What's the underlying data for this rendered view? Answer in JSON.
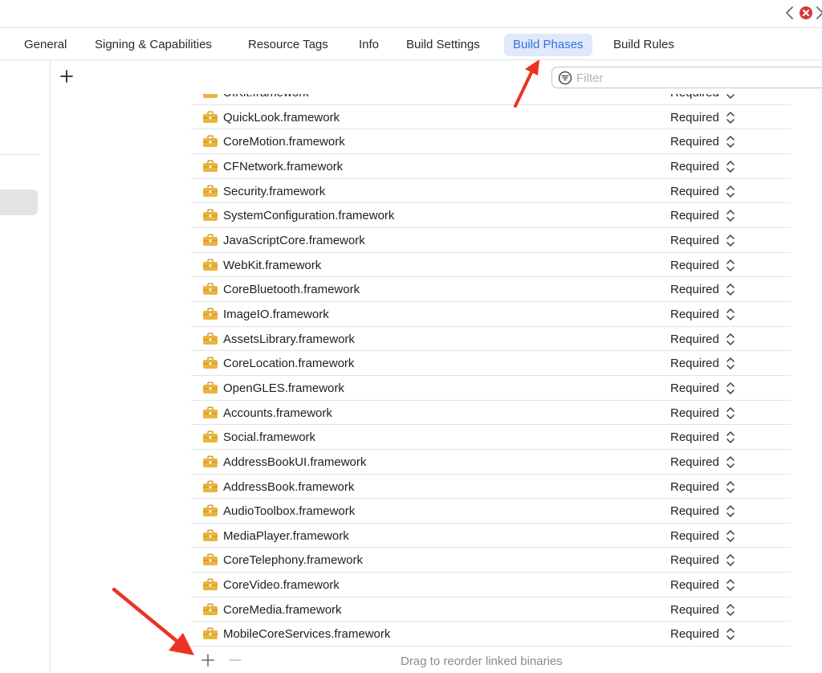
{
  "tabs": [
    {
      "label": "General",
      "active": false
    },
    {
      "label": "Signing & Capabilities",
      "active": false
    },
    {
      "label": "Resource Tags",
      "active": false
    },
    {
      "label": "Info",
      "active": false
    },
    {
      "label": "Build Settings",
      "active": false
    },
    {
      "label": "Build Phases",
      "active": true
    },
    {
      "label": "Build Rules",
      "active": false
    }
  ],
  "toolbar": {
    "add_icon": "plus-icon",
    "filter": {
      "placeholder": "Filter",
      "value": "",
      "icon": "filter-icon"
    }
  },
  "frameworks": [
    {
      "name": "UIKit.framework",
      "status": "Required"
    },
    {
      "name": "QuickLook.framework",
      "status": "Required"
    },
    {
      "name": "CoreMotion.framework",
      "status": "Required"
    },
    {
      "name": "CFNetwork.framework",
      "status": "Required"
    },
    {
      "name": "Security.framework",
      "status": "Required"
    },
    {
      "name": "SystemConfiguration.framework",
      "status": "Required"
    },
    {
      "name": "JavaScriptCore.framework",
      "status": "Required"
    },
    {
      "name": "WebKit.framework",
      "status": "Required"
    },
    {
      "name": "CoreBluetooth.framework",
      "status": "Required"
    },
    {
      "name": "ImageIO.framework",
      "status": "Required"
    },
    {
      "name": "AssetsLibrary.framework",
      "status": "Required"
    },
    {
      "name": "CoreLocation.framework",
      "status": "Required"
    },
    {
      "name": "OpenGLES.framework",
      "status": "Required"
    },
    {
      "name": "Accounts.framework",
      "status": "Required"
    },
    {
      "name": "Social.framework",
      "status": "Required"
    },
    {
      "name": "AddressBookUI.framework",
      "status": "Required"
    },
    {
      "name": "AddressBook.framework",
      "status": "Required"
    },
    {
      "name": "AudioToolbox.framework",
      "status": "Required"
    },
    {
      "name": "MediaPlayer.framework",
      "status": "Required"
    },
    {
      "name": "CoreTelephony.framework",
      "status": "Required"
    },
    {
      "name": "CoreVideo.framework",
      "status": "Required"
    },
    {
      "name": "CoreMedia.framework",
      "status": "Required"
    },
    {
      "name": "MobileCoreServices.framework",
      "status": "Required"
    }
  ],
  "footer": {
    "hint": "Drag to reorder linked binaries",
    "add_icon": "plus-icon",
    "remove_icon": "minus-icon"
  },
  "colors": {
    "accent": "#2f72de",
    "active_tab_bg": "#dfe9f9",
    "framework_icon": "#e9b53a",
    "annotation_arrow": "#ea3323",
    "close_badge": "#d83a35"
  }
}
